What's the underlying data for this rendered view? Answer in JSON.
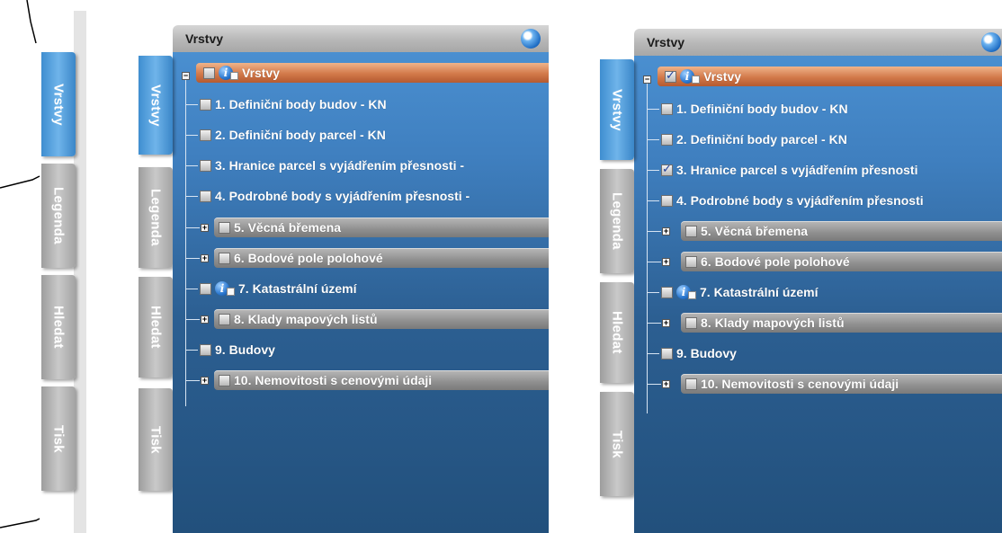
{
  "tabs": [
    "Vrstvy",
    "Legenda",
    "Hledat",
    "Tisk"
  ],
  "panel": {
    "title": "Vrstvy"
  },
  "layers": {
    "root": "Vrstvy",
    "items": [
      "1. Definiční body budov - KN",
      "2. Definiční body parcel - KN",
      "3. Hranice parcel s vyjádřením přesnosti -",
      "4. Podrobné body s vyjádřením přesnosti -",
      "5. Věcná břemena",
      "6. Bodové pole polohové",
      "7. Katastrální území",
      "8. Klady mapových listů",
      "9. Budovy",
      "10. Nemovitosti s cenovými údaji"
    ],
    "items_right": [
      "3. Hranice parcel s vyjádřením přesnosti",
      "4. Podrobné body s vyjádřením přesnosti"
    ]
  },
  "states": {
    "panel_a": {
      "root_checked": false,
      "item3_checked": false
    },
    "panel_b": {
      "root_checked": true,
      "item3_checked": true
    }
  }
}
